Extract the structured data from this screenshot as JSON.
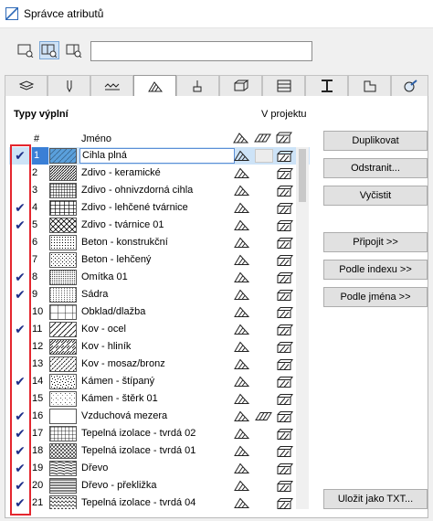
{
  "window": {
    "title": "Správce atributů"
  },
  "search": {
    "value": ""
  },
  "section": {
    "label": "Typy výplní",
    "in_project": "V projektu"
  },
  "table": {
    "col_num": "#",
    "col_name": "Jméno"
  },
  "buttons": {
    "duplicate": "Duplikovat",
    "remove": "Odstranit...",
    "clear": "Vyčistit",
    "attach": "Připojit >>",
    "by_index": "Podle indexu >>",
    "by_name": "Podle jména >>",
    "save_txt": "Uložit jako TXT..."
  },
  "colors": {
    "check": "#1f2f8a",
    "highlight": "#e4262e",
    "selection": "#cde3f7"
  },
  "rows": [
    {
      "num": "1",
      "name": "Cihla plná",
      "checked": true,
      "pattern": "solid-blue",
      "selected": true
    },
    {
      "num": "2",
      "name": "Zdivo - keramické",
      "checked": false,
      "pattern": "diag-dense"
    },
    {
      "num": "3",
      "name": "Zdivo - ohnivzdorná cihla",
      "checked": false,
      "pattern": "grid-dense"
    },
    {
      "num": "4",
      "name": "Zdivo - lehčené tvárnice",
      "checked": true,
      "pattern": "grid-bold"
    },
    {
      "num": "5",
      "name": "Zdivo - tvárnice 01",
      "checked": true,
      "pattern": "crosshatch"
    },
    {
      "num": "6",
      "name": "Beton - konstrukční",
      "checked": false,
      "pattern": "dots-dense"
    },
    {
      "num": "7",
      "name": "Beton - lehčený",
      "checked": false,
      "pattern": "dots-sparse"
    },
    {
      "num": "8",
      "name": "Omítka 01",
      "checked": true,
      "pattern": "dots-fine"
    },
    {
      "num": "9",
      "name": "Sádra",
      "checked": true,
      "pattern": "dots-tiny"
    },
    {
      "num": "10",
      "name": "Obklad/dlažba",
      "checked": false,
      "pattern": "tile"
    },
    {
      "num": "11",
      "name": "Kov - ocel",
      "checked": true,
      "pattern": "diag-sparse"
    },
    {
      "num": "12",
      "name": "Kov - hliník",
      "checked": false,
      "pattern": "diag-double"
    },
    {
      "num": "13",
      "name": "Kov - mosaz/bronz",
      "checked": false,
      "pattern": "diag-dash"
    },
    {
      "num": "14",
      "name": "Kámen - štípaný",
      "checked": true,
      "pattern": "dots-random"
    },
    {
      "num": "15",
      "name": "Kámen - štěrk 01",
      "checked": false,
      "pattern": "dots-light"
    },
    {
      "num": "16",
      "name": "Vzduchová mezera",
      "checked": true,
      "pattern": "empty"
    },
    {
      "num": "17",
      "name": "Tepelná izolace - tvrdá 02",
      "checked": true,
      "pattern": "grid-fine"
    },
    {
      "num": "18",
      "name": "Tepelná izolace - tvrdá 01",
      "checked": true,
      "pattern": "zigzag"
    },
    {
      "num": "19",
      "name": "Dřevo",
      "checked": true,
      "pattern": "wood"
    },
    {
      "num": "20",
      "name": "Dřevo - překližka",
      "checked": true,
      "pattern": "hlines"
    },
    {
      "num": "21",
      "name": "Tepelná izolace - tvrdá 04",
      "checked": true,
      "pattern": "waves"
    }
  ]
}
